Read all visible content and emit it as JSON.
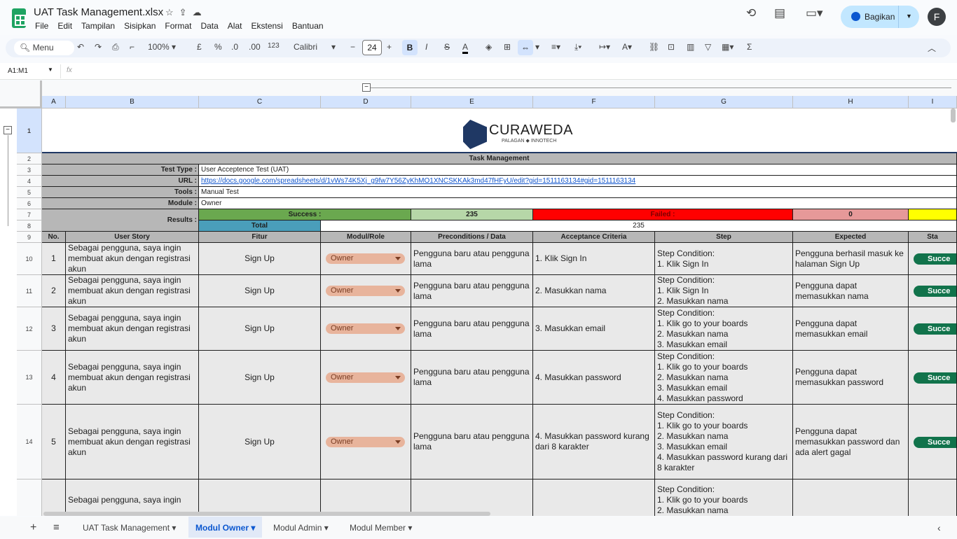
{
  "app": {
    "title": "UAT Task Management.xlsx",
    "menu": [
      "File",
      "Edit",
      "Tampilan",
      "Sisipkan",
      "Format",
      "Data",
      "Alat",
      "Ekstensi",
      "Bantuan"
    ],
    "share_label": "Bagikan",
    "avatar_letter": "F"
  },
  "toolbar": {
    "search": "Menu",
    "zoom": "100%",
    "currency": "£",
    "percent": "%",
    "dec_less": ".0",
    "dec_more": ".00",
    "num_format": "123",
    "font": "Calibri",
    "font_size": "24",
    "bold": "B",
    "italic": "I",
    "strike": "S",
    "text_color": "A",
    "sum": "Σ"
  },
  "formula_bar": {
    "name_box": "A1:M1",
    "fx": "fx"
  },
  "columns": [
    "A",
    "B",
    "C",
    "D",
    "E",
    "F",
    "G",
    "H",
    "I"
  ],
  "header_rows": {
    "logo_text": "CURAWEDA",
    "logo_sub": "PALAGAN ◆ INNOTECH",
    "task_title": "Task Management",
    "test_type_label": "Test Type :",
    "test_type": "User Acceptence Test (UAT)",
    "url_label": "URL :",
    "url": "https://docs.google.com/spreadsheets/d/1vWs74K5Xj_g9fw7Y56ZyKhMO1XNCSKKAk3md47fHFyU/edit?gid=1511163134#gid=1511163134",
    "tools_label": "Tools :",
    "tools": "Manual Test",
    "module_label": "Module :",
    "module": "Owner",
    "results_label": "Results :",
    "success_label": "Success :",
    "success_count": "235",
    "failed_label": "Failed :",
    "failed_count": "0",
    "total_label": "Total",
    "total_count": "235"
  },
  "table_headers": [
    "No.",
    "User Story",
    "Fitur",
    "Modul/Role",
    "Preconditions / Data",
    "Acceptance Criteria",
    "Step",
    "Expected",
    "Sta"
  ],
  "rows": [
    {
      "row": "10",
      "no": "1",
      "story": "Sebagai pengguna, saya ingin membuat  akun dengan registrasi akun",
      "fitur": "Sign Up",
      "role": "Owner",
      "pre": "Pengguna baru atau pengguna lama",
      "criteria": "1. Klik Sign In",
      "step": "Step Condition:\n1. Klik Sign In",
      "expected": "Pengguna berhasil masuk ke halaman Sign Up",
      "status": "Succe"
    },
    {
      "row": "11",
      "no": "2",
      "story": "Sebagai pengguna, saya ingin membuat  akun dengan registrasi akun",
      "fitur": "Sign Up",
      "role": "Owner",
      "pre": "Pengguna baru atau pengguna lama",
      "criteria": "2. Masukkan nama",
      "step": "Step Condition:\n1. Klik Sign In\n2. Masukkan nama",
      "expected": "Pengguna dapat memasukkan nama",
      "status": "Succe"
    },
    {
      "row": "12",
      "no": "3",
      "story": "Sebagai pengguna, saya ingin membuat  akun dengan registrasi akun",
      "fitur": "Sign Up",
      "role": "Owner",
      "pre": "Pengguna baru atau pengguna lama",
      "criteria": "3. Masukkan email",
      "step": "Step Condition:\n1. Klik go to your boards\n2. Masukkan nama\n3. Masukkan email",
      "expected": "Pengguna dapat memasukkan email",
      "status": "Succe"
    },
    {
      "row": "13",
      "no": "4",
      "story": "Sebagai pengguna, saya ingin membuat  akun dengan registrasi akun",
      "fitur": "Sign Up",
      "role": "Owner",
      "pre": "Pengguna baru atau pengguna lama",
      "criteria": "4. Masukkan password",
      "step": "Step Condition:\n1. Klik go to your boards\n2. Masukkan nama\n3. Masukkan email\n4. Masukkan password",
      "expected": "Pengguna dapat memasukkan password",
      "status": "Succe"
    },
    {
      "row": "14",
      "no": "5",
      "story": "Sebagai pengguna, saya ingin membuat  akun dengan registrasi akun",
      "fitur": "Sign Up",
      "role": "Owner",
      "pre": "Pengguna baru atau pengguna lama",
      "criteria": "4. Masukkan password kurang dari 8 karakter",
      "step": "Step Condition:\n1. Klik go to your boards\n2. Masukkan nama\n3. Masukkan email\n4. Masukkan password kurang dari 8 karakter",
      "expected": "Pengguna dapat memasukkan password dan ada alert gagal",
      "status": "Succe"
    },
    {
      "row": "",
      "no": "",
      "story": "Sebagai pengguna, saya ingin",
      "fitur": "",
      "role": "",
      "pre": "",
      "criteria": "",
      "step": "Step Condition:\n1. Klik go to your boards\n2. Masukkan nama",
      "expected": "",
      "status": ""
    }
  ],
  "sheet_tabs": [
    "UAT Task Management",
    "Modul Owner",
    "Modul Admin",
    "Modul Member"
  ],
  "active_tab": "Modul Owner"
}
